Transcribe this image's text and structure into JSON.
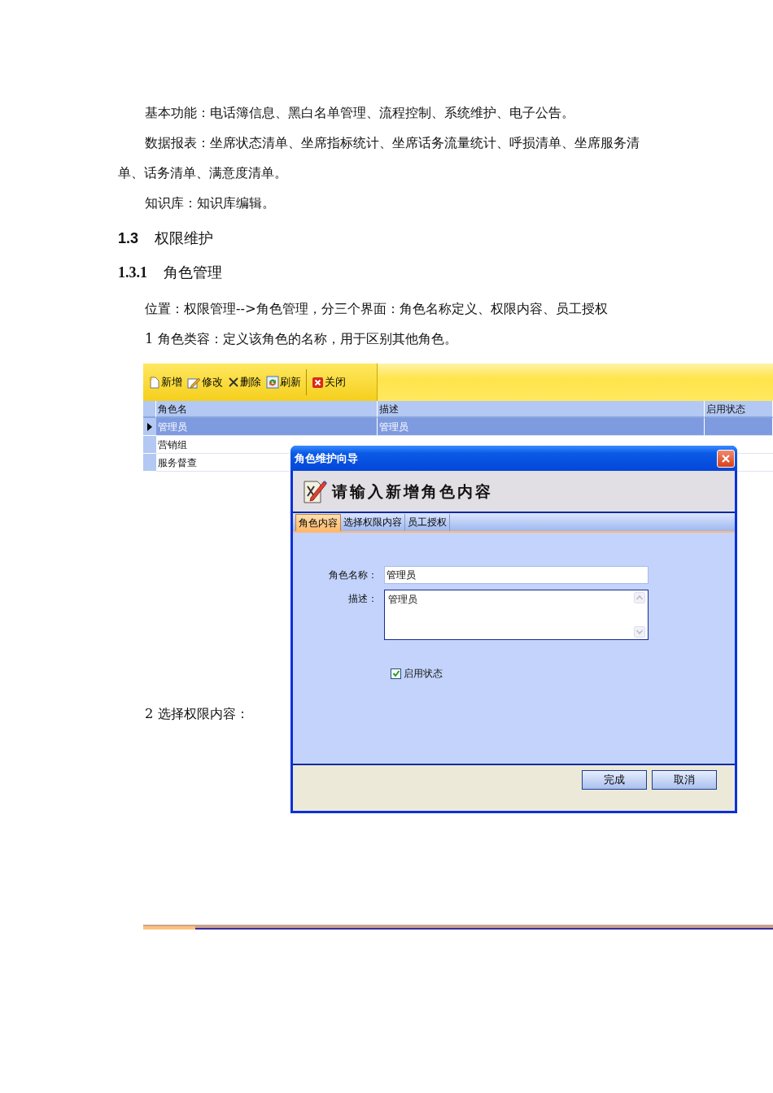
{
  "document": {
    "blocks": [
      {
        "kind": "para",
        "text": "基本功能：电话簿信息、黑白名单管理、流程控制、系统维护、电子公告。"
      },
      {
        "kind": "para",
        "text": "数据报表：坐席状态清单、坐席指标统计、坐席话务流量统计、呼损清单、坐席服务清单、话务清单、满意度清单。"
      },
      {
        "kind": "para",
        "text": "知识库：知识库编辑。"
      },
      {
        "kind": "heading",
        "number": "1.3",
        "text": "权限维护"
      },
      {
        "kind": "subheading",
        "number": "1.3.1",
        "text": "角色管理"
      },
      {
        "kind": "para",
        "text": "位置：权限管理-->角色管理，分三个界面：角色名称定义、权限内容、员工授权"
      },
      {
        "kind": "para",
        "text": "1 角色类容：定义该角色的名称，用于区别其他角色。"
      }
    ]
  },
  "screenshot": {
    "toolbar": [
      {
        "kind": "new",
        "label": "新增"
      },
      {
        "kind": "edit",
        "label": "修改"
      },
      {
        "kind": "delete",
        "label": "删除"
      },
      {
        "kind": "refresh",
        "label": "刷新"
      },
      {
        "kind": "close",
        "label": "关闭"
      }
    ],
    "table": {
      "columns": [
        "角色名",
        "描述",
        "启用状态"
      ],
      "rows": [
        {
          "cells": [
            "管理员",
            "管理员"
          ],
          "selected": true
        },
        {
          "cells": [
            "营销组"
          ],
          "selected": false
        },
        {
          "cells": [
            "服务督查"
          ],
          "selected": false
        }
      ]
    },
    "dialog": {
      "title": "角色维护向导",
      "heading": "请输入新增角色内容",
      "tabs": [
        {
          "label": "角色内容",
          "selected": true
        },
        {
          "label": "选择权限内容",
          "selected": false
        },
        {
          "label": "员工授权",
          "selected": false
        }
      ],
      "name_field": {
        "label": "角色名称：",
        "value": "管理员"
      },
      "description_field": {
        "label": "描述：",
        "value": "管理员"
      },
      "enabled_checkbox": {
        "label": "启用状态",
        "checked": true
      },
      "buttons": [
        "完成",
        "取消"
      ]
    }
  },
  "after": {
    "text": "2  选择权限内容："
  }
}
